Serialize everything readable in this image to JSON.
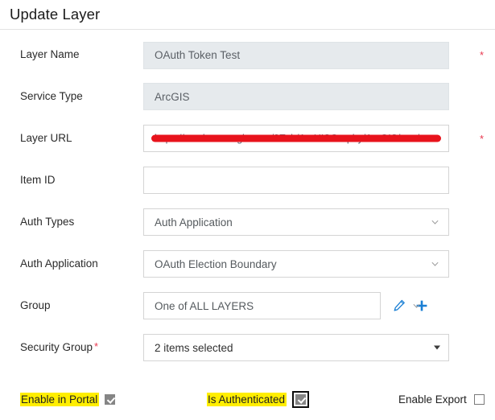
{
  "header": {
    "title": "Update Layer"
  },
  "form": {
    "rows": [
      {
        "label": "Layer Name",
        "value": "OAuth Token Test",
        "required_marker": "*"
      },
      {
        "label": "Service Type",
        "value": "ArcGIS"
      },
      {
        "label": "Layer URL",
        "value": "https://services.arcgis.com/2Ech/ArcHISGraphy/ArcGIS/rest/",
        "required_marker": "*"
      },
      {
        "label": "Item ID",
        "value": ""
      },
      {
        "label": "Auth Types",
        "value": "Auth Application"
      },
      {
        "label": "Auth Application",
        "value": "OAuth Election Boundary"
      },
      {
        "label": "Group",
        "value": "One of ALL LAYERS",
        "edit_icon": "pencil-icon",
        "add_icon": "plus-icon"
      },
      {
        "label": "Security Group",
        "required_marker": "*",
        "value": "2 items selected"
      }
    ]
  },
  "checkboxes": [
    {
      "label": "Enable in Portal",
      "checked": true,
      "highlighted": true,
      "focused": false
    },
    {
      "label": "Is Authenticated",
      "checked": true,
      "highlighted": true,
      "focused": true
    },
    {
      "label": "Enable Export",
      "checked": false,
      "highlighted": false,
      "focused": false
    }
  ],
  "colors": {
    "highlight": "#ffee00",
    "required": "#e8384f",
    "redaction": "#e8131c",
    "icon_blue": "#1a7fd4",
    "disabled_field": "#e6eaed"
  }
}
